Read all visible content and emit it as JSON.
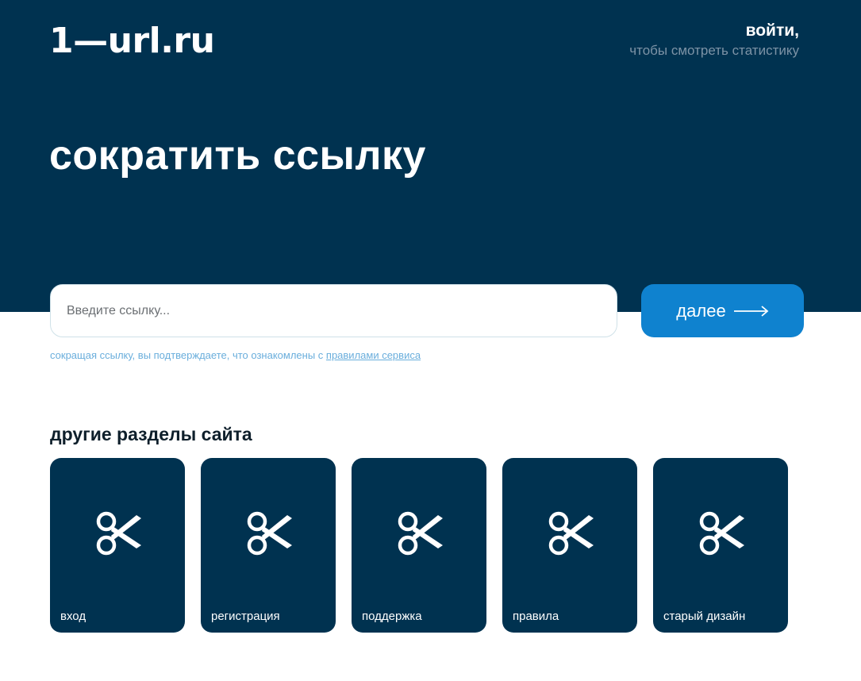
{
  "header": {
    "logo_text": "1—url.ru",
    "login_label": "войти,",
    "login_sub": "чтобы смотреть статистику"
  },
  "hero": {
    "title": "сократить ссылку"
  },
  "form": {
    "input_placeholder": "Введите ссылку...",
    "input_value": "",
    "submit_label": "далее"
  },
  "terms": {
    "text": "сокращая ссылку, вы подтверждаете, что ознакомлены с ",
    "link_label": "правилами сервиса"
  },
  "sections": {
    "title": "другие разделы сайта",
    "items": [
      {
        "label": "вход",
        "icon": "scissors-icon"
      },
      {
        "label": "регистрация",
        "icon": "scissors-icon"
      },
      {
        "label": "поддержка",
        "icon": "scissors-icon"
      },
      {
        "label": "правила",
        "icon": "scissors-icon"
      },
      {
        "label": "старый дизайн",
        "icon": "scissors-icon"
      }
    ]
  },
  "colors": {
    "hero_bg": "#003250",
    "accent": "#0f82cf",
    "terms_text": "#6aaedc",
    "card_bg": "#003250"
  }
}
